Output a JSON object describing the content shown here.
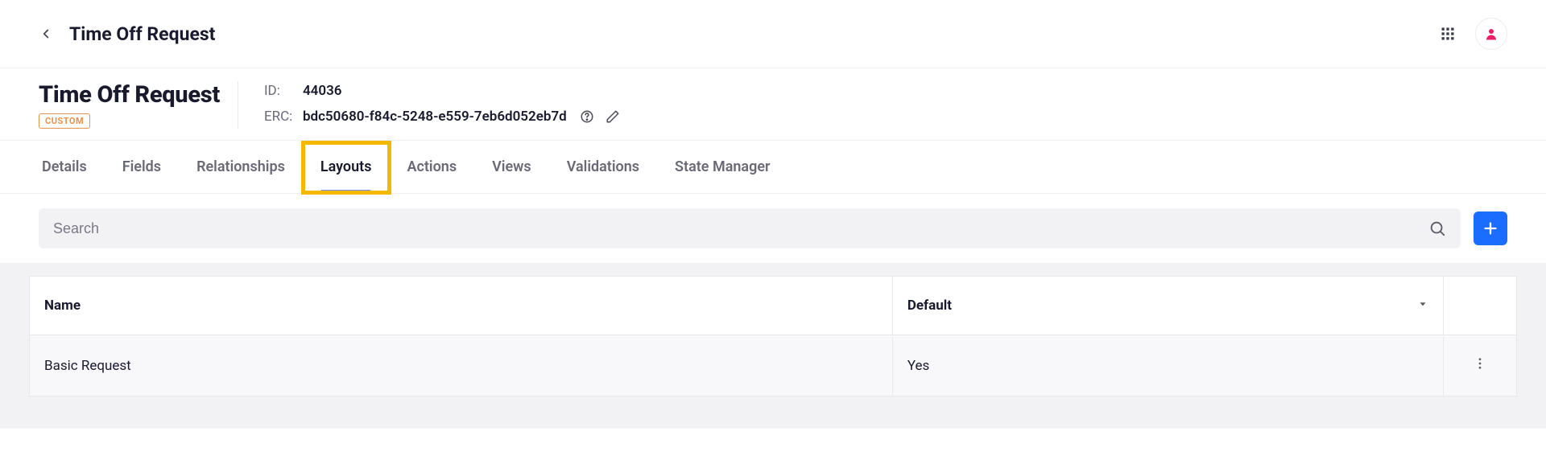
{
  "header": {
    "title": "Time Off Request"
  },
  "entity": {
    "name": "Time Off Request",
    "badge": "CUSTOM",
    "id_label": "ID:",
    "id_value": "44036",
    "erc_label": "ERC:",
    "erc_value": "bdc50680-f84c-5248-e559-7eb6d052eb7d"
  },
  "tabs": [
    {
      "label": "Details",
      "active": false
    },
    {
      "label": "Fields",
      "active": false
    },
    {
      "label": "Relationships",
      "active": false
    },
    {
      "label": "Layouts",
      "active": true
    },
    {
      "label": "Actions",
      "active": false
    },
    {
      "label": "Views",
      "active": false
    },
    {
      "label": "Validations",
      "active": false
    },
    {
      "label": "State Manager",
      "active": false
    }
  ],
  "search": {
    "placeholder": "Search"
  },
  "table": {
    "columns": {
      "name": "Name",
      "default": "Default"
    },
    "rows": [
      {
        "name": "Basic Request",
        "default": "Yes"
      }
    ]
  }
}
